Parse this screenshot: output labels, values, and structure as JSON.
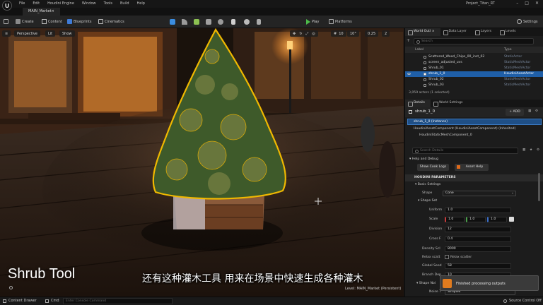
{
  "menubar": {
    "items": [
      "File",
      "Edit",
      "Houdini Engine",
      "Window",
      "Tools",
      "Build",
      "Help"
    ],
    "project": "Project_Titan_RT"
  },
  "level_tab": "MAIN_Market",
  "toolbar": {
    "save": "",
    "create": "Create",
    "content": "Content",
    "blueprints": "Blueprints",
    "cinematics": "Cinematics",
    "play": "Play",
    "platforms": "Platforms",
    "settings": "Settings"
  },
  "viewport": {
    "perspective": "Perspective",
    "lit": "Lit",
    "show": "Show",
    "grid": "10",
    "angle": "10°",
    "scale": "0.25",
    "cam": "2",
    "level_label": "Level: MAIN_Market (Persistent)"
  },
  "overlay": {
    "title": "Shrub Tool",
    "subtitle": "还有这种灌木工具 用来在场景中快速生成各种灌木",
    "notification": "Finished processing outputs"
  },
  "outliner": {
    "tabs": [
      "World Outl ×",
      "Data Layer",
      "Layers",
      "Levels"
    ],
    "search": "Search",
    "col_label": "Label",
    "col_type": "Type",
    "rows": [
      {
        "name": "Scattered_Wood_Chips_00_inst_02",
        "type": "StaticActor"
      },
      {
        "name": "screen_adjusted_uvs",
        "type": "StaticMeshActor"
      },
      {
        "name": "Shrub_01",
        "type": "StaticMeshActor"
      },
      {
        "name": "shrub_1_0",
        "type": "HoudiniAssetActor",
        "selected": true
      },
      {
        "name": "Shrub_02",
        "type": "StaticMeshActor"
      },
      {
        "name": "Shrub_03",
        "type": "StaticMeshActor"
      }
    ],
    "footer": "3,059 actors (1 selected)"
  },
  "details": {
    "tabs": [
      "Details",
      "World Settings"
    ],
    "actor": "shrub_1_0",
    "add": "+ ADD",
    "instance": "shrub_1_0 (Instance)",
    "components": [
      "HoudiniAssetComponent (HoudiniAssetComponent) (Inherited)",
      "HoudiniStaticMeshComponent_0"
    ],
    "search": "Search Details",
    "help_section": "Help and Debug",
    "show_cook_logs": "Show Cook Logs",
    "asset_help": "Asset Help",
    "params_section": "HOUDINI PARAMETERS",
    "basic_settings": "Basic Settings",
    "shape_label": "Shape",
    "shape_value": "Cone",
    "shape_set": "Shape Set",
    "uniform_label": "Uniform",
    "uniform_value": "1.0",
    "scale_label": "Scale",
    "scale_x": "1.0",
    "scale_y": "1.0",
    "scale_z": "1.0",
    "divisions_label": "Division",
    "divisions_value": "12",
    "cross_label": "Cross F",
    "cross_value": "0.4",
    "density_label": "Density Scl",
    "density_value": "8000",
    "relax_label": "Relax scatt",
    "relax_value": "Relax scatter",
    "global_label": "Global Seed",
    "global_value": "58",
    "branch_label": "Branch Dep",
    "branch_value": "10",
    "shape_noise": "Shape Noi",
    "noise_label": "Noise T",
    "noise_value": "Simplex"
  },
  "statusbar": {
    "content_drawer": "Content Drawer",
    "cmd": "Cmd",
    "console": "Enter Console Command",
    "source_control": "Source Control Off"
  }
}
